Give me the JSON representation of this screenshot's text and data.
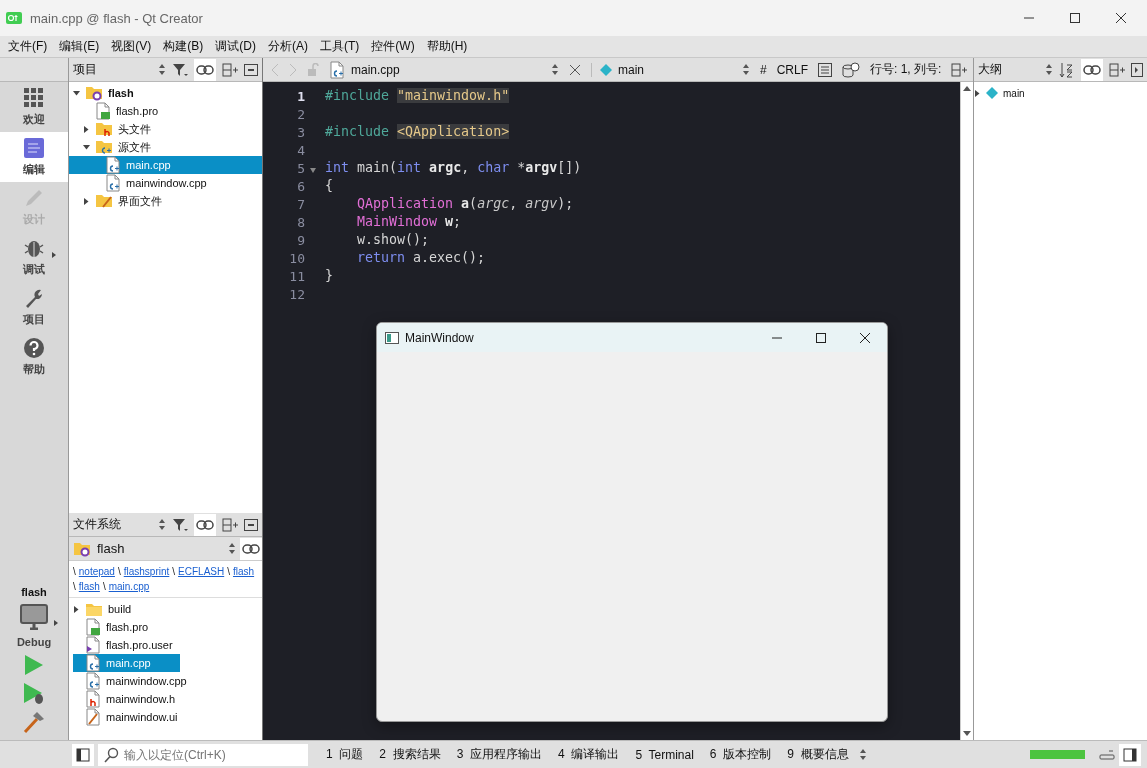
{
  "window": {
    "title": "main.cpp @ flash - Qt Creator"
  },
  "menu": [
    "文件(F)",
    "编辑(E)",
    "视图(V)",
    "构建(B)",
    "调试(D)",
    "分析(A)",
    "工具(T)",
    "控件(W)",
    "帮助(H)"
  ],
  "modes": [
    {
      "label": "欢迎",
      "kind": "grid",
      "selected": false,
      "disabled": false,
      "submenu": false
    },
    {
      "label": "编辑",
      "kind": "edit",
      "selected": true,
      "disabled": false,
      "submenu": false
    },
    {
      "label": "设计",
      "kind": "pencil",
      "selected": false,
      "disabled": true,
      "submenu": false
    },
    {
      "label": "调试",
      "kind": "bug",
      "selected": false,
      "disabled": false,
      "submenu": true
    },
    {
      "label": "项目",
      "kind": "wrench",
      "selected": false,
      "disabled": false,
      "submenu": false
    },
    {
      "label": "帮助",
      "kind": "help",
      "selected": false,
      "disabled": false,
      "submenu": false
    }
  ],
  "kit": {
    "project": "flash",
    "build": "Debug"
  },
  "project_panel": {
    "title": "项目",
    "tree": [
      {
        "label": "flash",
        "kind": "project",
        "bold": true,
        "expanded": true,
        "selected": false,
        "children": [
          {
            "label": "flash.pro",
            "kind": "pro",
            "bold": false,
            "selected": false
          },
          {
            "label": "头文件",
            "kind": "header-folder",
            "bold": false,
            "expanded": false,
            "selected": false
          },
          {
            "label": "源文件",
            "kind": "source-folder",
            "bold": false,
            "expanded": true,
            "selected": false,
            "children": [
              {
                "label": "main.cpp",
                "kind": "cpp",
                "bold": false,
                "selected": true
              },
              {
                "label": "mainwindow.cpp",
                "kind": "cpp",
                "bold": false,
                "selected": false
              }
            ]
          },
          {
            "label": "界面文件",
            "kind": "form-folder",
            "bold": false,
            "expanded": false,
            "selected": false
          }
        ]
      }
    ]
  },
  "filesystem_panel": {
    "title": "文件系统",
    "folder": "flash",
    "separator": "\\",
    "path": [
      "notepad",
      "flashsprint",
      "ECFLASH",
      "flash",
      "flash",
      "main.cpp"
    ],
    "items": [
      {
        "label": "build",
        "kind": "folder",
        "expanded": false,
        "selected": false
      },
      {
        "label": "flash.pro",
        "kind": "pro",
        "selected": false
      },
      {
        "label": "flash.pro.user",
        "kind": "user",
        "selected": false
      },
      {
        "label": "main.cpp",
        "kind": "cpp",
        "selected": true
      },
      {
        "label": "mainwindow.cpp",
        "kind": "cpp",
        "selected": false
      },
      {
        "label": "mainwindow.h",
        "kind": "h",
        "selected": false
      },
      {
        "label": "mainwindow.ui",
        "kind": "ui",
        "selected": false
      }
    ]
  },
  "editor_toolbar": {
    "file": "main.cpp",
    "symbol": "main",
    "hash": "#",
    "line_ending": "CRLF",
    "position": "行号: 1, 列号:"
  },
  "code": [
    {
      "number": "1",
      "current": true,
      "fold": false,
      "tokens": [
        {
          "text": "#include ",
          "kind": "preprocessor"
        },
        {
          "text": "\"mainwindow.h\"",
          "kind": "string"
        }
      ]
    },
    {
      "number": "2",
      "current": false,
      "fold": false
    },
    {
      "number": "3",
      "current": false,
      "fold": false,
      "tokens": [
        {
          "text": "#include ",
          "kind": "preprocessor"
        },
        {
          "text": "<QApplication>",
          "kind": "string"
        }
      ]
    },
    {
      "number": "4",
      "current": false,
      "fold": false
    },
    {
      "number": "5",
      "current": false,
      "fold": true,
      "tokens": [
        {
          "text": "int",
          "kind": "keyword"
        },
        {
          "text": " main(",
          "kind": "plain"
        },
        {
          "text": "int",
          "kind": "keyword"
        },
        {
          "text": " argc",
          "kind": "variable"
        },
        {
          "text": ", ",
          "kind": "plain"
        },
        {
          "text": "char",
          "kind": "keyword"
        },
        {
          "text": " *",
          "kind": "plain"
        },
        {
          "text": "argv",
          "kind": "variable"
        },
        {
          "text": "[])",
          "kind": "plain"
        }
      ]
    },
    {
      "number": "6",
      "current": false,
      "fold": false,
      "tokens": [
        {
          "text": "{",
          "kind": "plain"
        }
      ]
    },
    {
      "number": "7",
      "current": false,
      "fold": false,
      "tokens": [
        {
          "text": "    QApplication",
          "kind": "type"
        },
        {
          "text": " a",
          "kind": "variable"
        },
        {
          "text": "(",
          "kind": "plain"
        },
        {
          "text": "argc",
          "kind": "parameter"
        },
        {
          "text": ", ",
          "kind": "plain"
        },
        {
          "text": "argv",
          "kind": "parameter"
        },
        {
          "text": ");",
          "kind": "plain"
        }
      ]
    },
    {
      "number": "8",
      "current": false,
      "fold": false,
      "tokens": [
        {
          "text": "    MainWindow",
          "kind": "type"
        },
        {
          "text": " w",
          "kind": "variable"
        },
        {
          "text": ";",
          "kind": "plain"
        }
      ]
    },
    {
      "number": "9",
      "current": false,
      "fold": false,
      "tokens": [
        {
          "text": "    w.show();",
          "kind": "plain"
        }
      ]
    },
    {
      "number": "10",
      "current": false,
      "fold": false,
      "tokens": [
        {
          "text": "    return",
          "kind": "keyword"
        },
        {
          "text": " a.exec();",
          "kind": "plain"
        }
      ]
    },
    {
      "number": "11",
      "current": false,
      "fold": false,
      "tokens": [
        {
          "text": "}",
          "kind": "plain"
        }
      ]
    },
    {
      "number": "12",
      "current": false,
      "fold": false
    }
  ],
  "outline": {
    "title": "大纲",
    "items": [
      {
        "label": "main",
        "expanded": false
      }
    ]
  },
  "status_bar": {
    "locator_placeholder": "输入以定位(Ctrl+K)",
    "panes": [
      "1  问题",
      "2  搜索结果",
      "3  应用程序输出",
      "4  编译输出",
      "5  Terminal",
      "6  版本控制",
      "9  概要信息"
    ],
    "progress": {
      "level": 1
    }
  },
  "dialog": {
    "title": "MainWindow"
  }
}
